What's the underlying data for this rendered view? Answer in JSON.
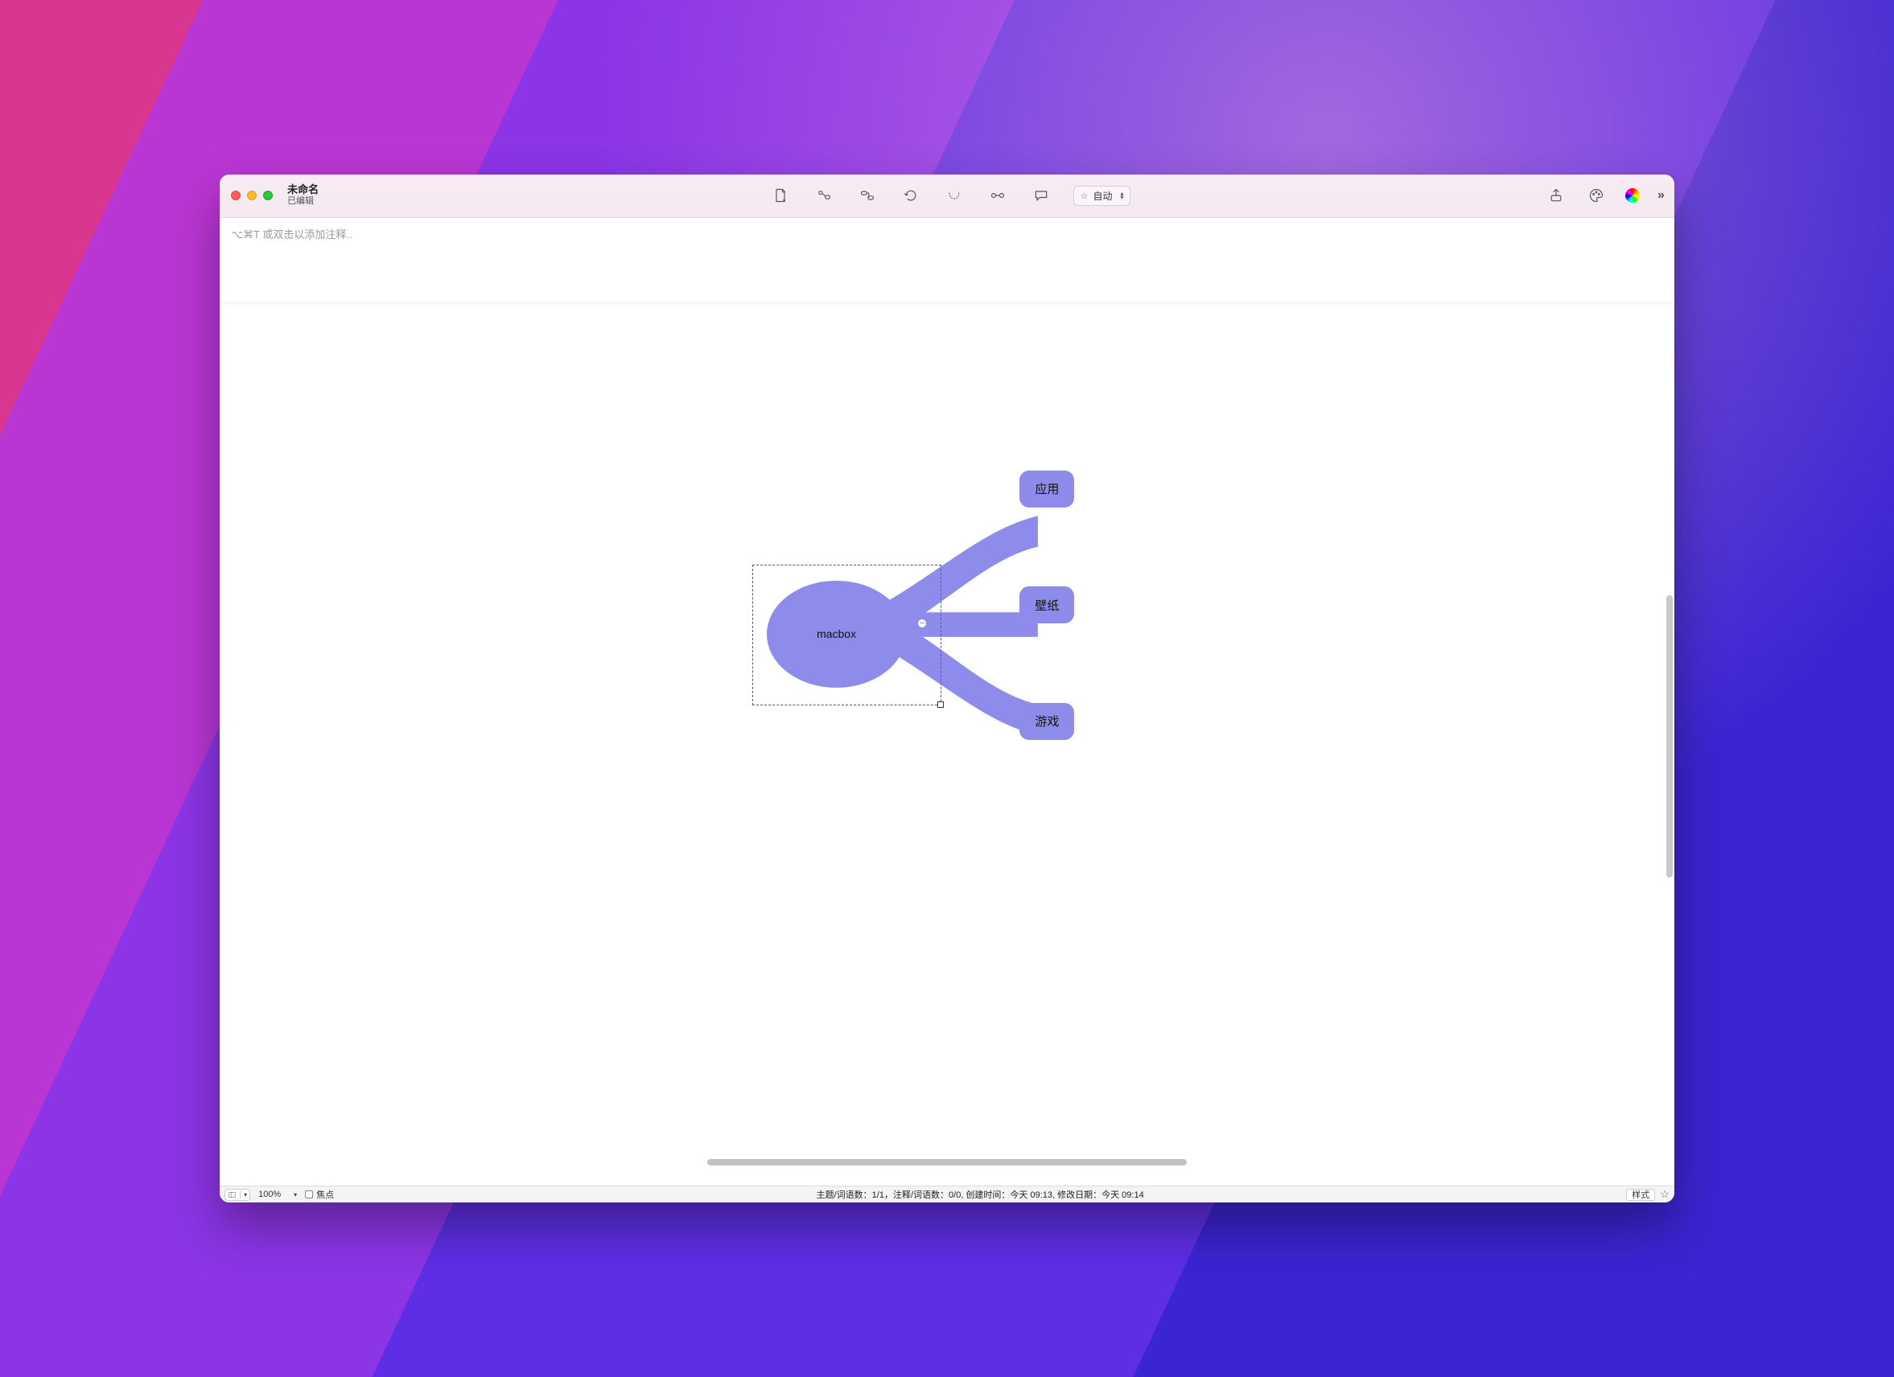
{
  "window": {
    "title": "未命名",
    "subtitle": "已编辑"
  },
  "toolbar": {
    "layout_label": "自动"
  },
  "notes": {
    "placeholder": "⌥⌘T 或双击以添加注释.."
  },
  "mindmap": {
    "root": "macbox",
    "children": [
      "应用",
      "壁纸",
      "游戏"
    ]
  },
  "statusbar": {
    "zoom": "100%",
    "focus_label": "焦点",
    "info": "主题/词语数：1/1，注释/词语数：0/0, 创建时间：今天 09:13, 修改日期：今天 09:14",
    "style_label": "样式"
  }
}
